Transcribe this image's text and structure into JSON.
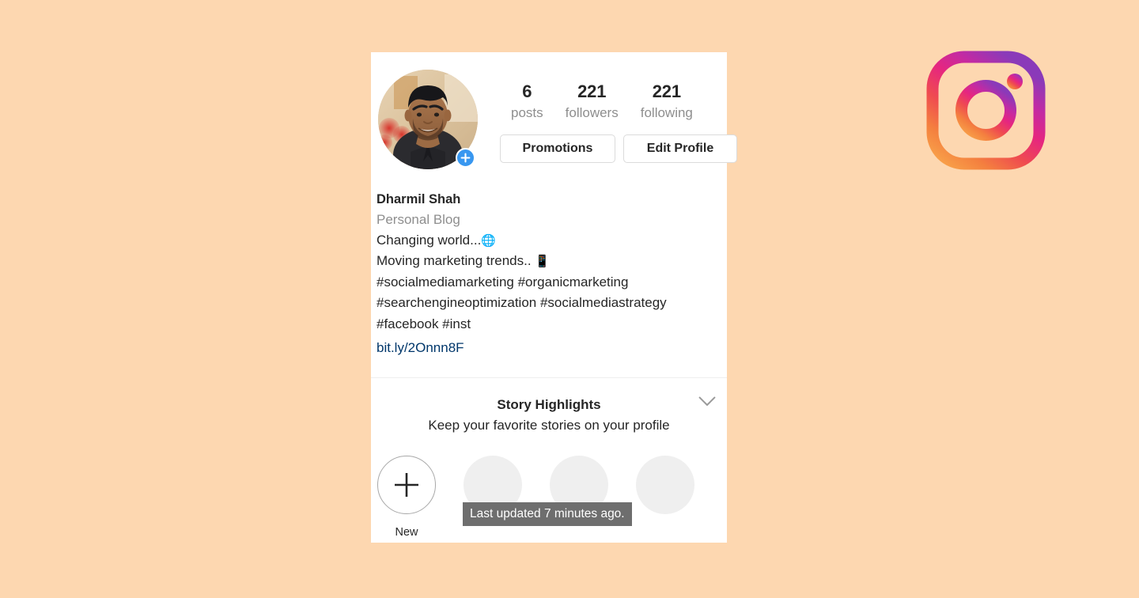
{
  "page": {
    "background_color": "#fdd7b0"
  },
  "profile": {
    "stats": [
      {
        "value": "6",
        "label": "posts"
      },
      {
        "value": "221",
        "label": "followers"
      },
      {
        "value": "221",
        "label": "following"
      }
    ],
    "buttons": {
      "promotions": "Promotions",
      "edit_profile": "Edit Profile"
    },
    "avatar": {
      "alt": "Dharmil Shah profile photo",
      "add_badge_color": "#3897f0"
    },
    "bio": {
      "name": "Dharmil Shah",
      "category": "Personal Blog",
      "lines": [
        "Changing world...",
        "Moving marketing trends.. ",
        "#socialmediamarketing #organicmarketing",
        "#searchengineoptimization #socialmediastrategy",
        "#facebook #inst"
      ],
      "emoji_globe": "🌐",
      "emoji_phone": "📱",
      "link": "bit.ly/2Onnn8F",
      "link_color": "#00376b"
    }
  },
  "highlights": {
    "title": "Story Highlights",
    "subtitle": "Keep your favorite stories on your profile",
    "new_label": "New",
    "items": [
      {
        "type": "new",
        "label": "New"
      },
      {
        "type": "placeholder",
        "label": ""
      },
      {
        "type": "placeholder",
        "label": ""
      },
      {
        "type": "placeholder",
        "label": ""
      }
    ]
  },
  "tooltip": {
    "text": "Last updated 7 minutes ago.",
    "background": "#6e6e6e"
  },
  "logo": {
    "name": "instagram-logo",
    "gradient": [
      "#f9a84b",
      "#f15f4d",
      "#e9318c",
      "#c32aa3",
      "#8a3ab9"
    ]
  }
}
